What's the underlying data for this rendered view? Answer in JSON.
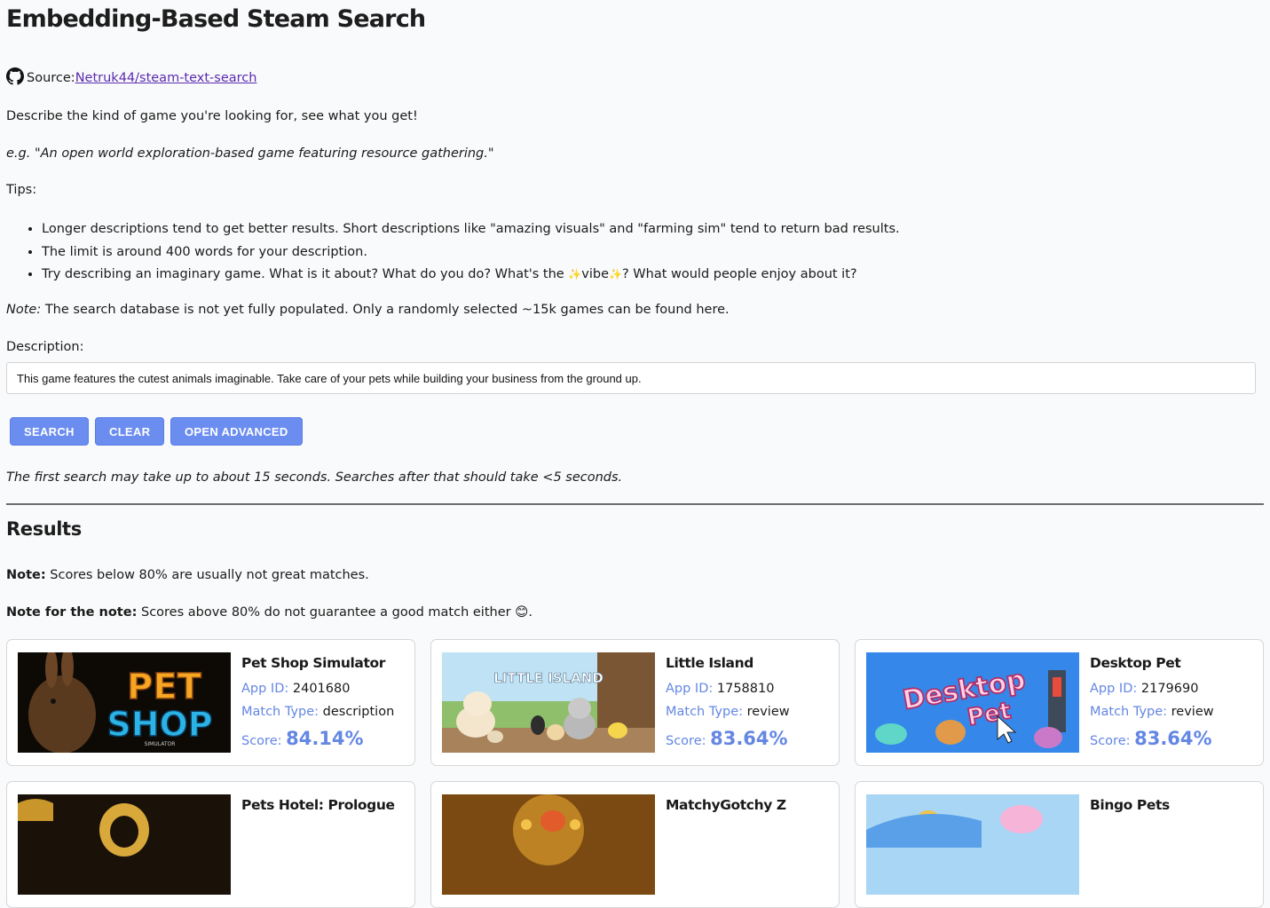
{
  "page": {
    "title": "Embedding-Based Steam Search",
    "source_label": "Source:",
    "source_link": "Netruk44/steam-text-search",
    "intro": "Describe the kind of game you're looking for, see what you get!",
    "example": "e.g. \"An open world exploration-based game featuring resource gathering.\"",
    "tips_label": "Tips:",
    "tips": [
      "Longer descriptions tend to get better results. Short descriptions like \"amazing visuals\" and \"farming sim\" tend to return bad results.",
      "The limit is around 400 words for your description."
    ],
    "tip3_before": "Try describing an imaginary game. What is it about? What do you do? What's the ",
    "tip3_sparkle": "✨",
    "tip3_vibe": "vibe",
    "tip3_after": "? What would people enjoy about it?",
    "note_label": "Note:",
    "note_text": " The search database is not yet fully populated. Only a randomly selected ~15k games can be found here.",
    "description_label": "Description:",
    "description_value": "This game features the cutest animals imaginable. Take care of your pets while building your business from the ground up.",
    "buttons": {
      "search": "SEARCH",
      "clear": "CLEAR",
      "advanced": "OPEN ADVANCED"
    },
    "timing_note": "The first search may take up to about 15 seconds. Searches after that should take <5 seconds."
  },
  "results": {
    "heading": "Results",
    "note_label": "Note:",
    "note_text": " Scores below 80% are usually not great matches.",
    "note2_label": "Note for the note:",
    "note2_text": " Scores above 80% do not guarantee a good match either 😊.",
    "labels": {
      "app_id": "App ID:",
      "match_type": "Match Type:",
      "score": "Score:"
    },
    "items": [
      {
        "title": "Pet Shop Simulator",
        "app_id": "2401680",
        "match_type": "description",
        "score": "84.14%",
        "thumb_text": "PET SHOP"
      },
      {
        "title": "Little Island",
        "app_id": "1758810",
        "match_type": "review",
        "score": "83.64%",
        "thumb_text": "LITTLE ISLAND"
      },
      {
        "title": "Desktop Pet",
        "app_id": "2179690",
        "match_type": "review",
        "score": "83.64%",
        "thumb_text": "Desktop Pet"
      },
      {
        "title": "Pets Hotel: Prologue"
      },
      {
        "title": "MatchyGotchy Z"
      },
      {
        "title": "Bingo Pets"
      }
    ]
  },
  "colors": {
    "accent": "#6b8df0",
    "label_blue": "#6487e3",
    "link": "#5b2bb0",
    "background": "#f9fafb"
  },
  "icons": {
    "source": "github-icon"
  }
}
